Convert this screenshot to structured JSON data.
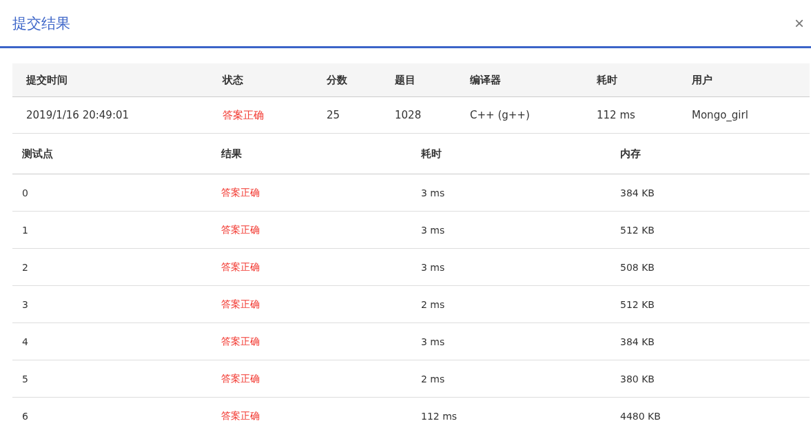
{
  "dialog": {
    "title": "提交结果",
    "close": "×"
  },
  "summary": {
    "columns": [
      "提交时间",
      "状态",
      "分数",
      "题目",
      "编译器",
      "耗时",
      "用户"
    ],
    "row": {
      "time": "2019/1/16 20:49:01",
      "status": {
        "text": "答案正确",
        "kind": "accepted"
      },
      "score": "25",
      "problem": "1028",
      "compiler": "C++ (g++)",
      "elapsed": "112 ms",
      "user": "Mongo_girl"
    }
  },
  "testcases": {
    "columns": [
      "测试点",
      "结果",
      "耗时",
      "内存"
    ],
    "rows": [
      {
        "id": "0",
        "result": {
          "text": "答案正确",
          "kind": "accepted"
        },
        "time": "3 ms",
        "memory": "384 KB"
      },
      {
        "id": "1",
        "result": {
          "text": "答案正确",
          "kind": "accepted"
        },
        "time": "3 ms",
        "memory": "512 KB"
      },
      {
        "id": "2",
        "result": {
          "text": "答案正确",
          "kind": "accepted"
        },
        "time": "3 ms",
        "memory": "508 KB"
      },
      {
        "id": "3",
        "result": {
          "text": "答案正确",
          "kind": "accepted"
        },
        "time": "2 ms",
        "memory": "512 KB"
      },
      {
        "id": "4",
        "result": {
          "text": "答案正确",
          "kind": "accepted"
        },
        "time": "3 ms",
        "memory": "384 KB"
      },
      {
        "id": "5",
        "result": {
          "text": "答案正确",
          "kind": "accepted"
        },
        "time": "2 ms",
        "memory": "380 KB"
      },
      {
        "id": "6",
        "result": {
          "text": "答案正确",
          "kind": "accepted"
        },
        "time": "112 ms",
        "memory": "4480 KB"
      }
    ]
  }
}
